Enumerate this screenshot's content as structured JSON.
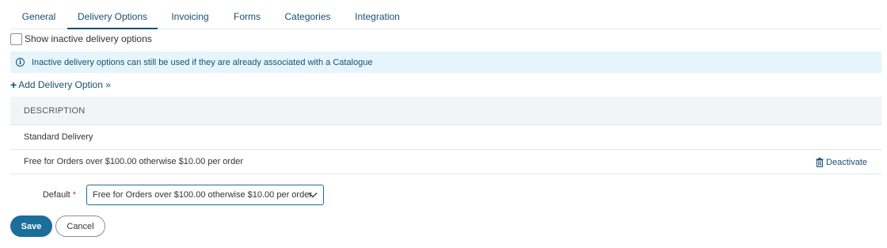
{
  "tabs": [
    {
      "label": "General"
    },
    {
      "label": "Delivery Options",
      "active": true
    },
    {
      "label": "Invoicing"
    },
    {
      "label": "Forms"
    },
    {
      "label": "Categories"
    },
    {
      "label": "Integration"
    }
  ],
  "show_inactive": {
    "label": "Show inactive delivery options",
    "checked": false
  },
  "info": {
    "icon": "info-icon",
    "text": "Inactive delivery options can still be used if they are already associated with a Catalogue"
  },
  "add_option": {
    "icon": "plus-icon",
    "label": "Add Delivery Option »"
  },
  "table": {
    "header": "DESCRIPTION",
    "rows": [
      {
        "description": "Standard Delivery"
      },
      {
        "description": "Free for Orders over $100.00 otherwise $10.00 per order",
        "action": "Deactivate"
      }
    ]
  },
  "default_field": {
    "label": "Default",
    "required_marker": "*",
    "selected": "Free for Orders over $100.00 otherwise $10.00 per order"
  },
  "buttons": {
    "save": "Save",
    "cancel": "Cancel"
  },
  "colors": {
    "accent": "#1a4f72",
    "primary_button": "#1a6f9a",
    "info_background": "#e5f5fb",
    "required": "#c0392b"
  }
}
